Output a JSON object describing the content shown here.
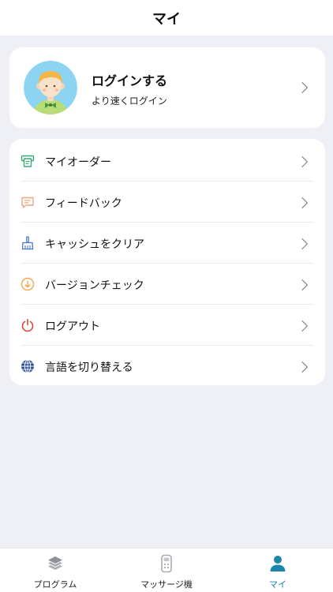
{
  "header": {
    "title": "マイ"
  },
  "profile": {
    "title": "ログインする",
    "subtitle": "より速くログイン",
    "avatar_icon": "boy-avatar-icon"
  },
  "menu": {
    "items": [
      {
        "label": "マイオーダー",
        "icon": "receipt-printer-icon",
        "icon_color": "#3aa873"
      },
      {
        "label": "フィードバック",
        "icon": "message-icon",
        "icon_color": "#f0a47a"
      },
      {
        "label": "キャッシュをクリア",
        "icon": "broom-icon",
        "icon_color": "#4a78c8"
      },
      {
        "label": "バージョンチェック",
        "icon": "download-circle-icon",
        "icon_color": "#f3a54d"
      },
      {
        "label": "ログアウト",
        "icon": "power-icon",
        "icon_color": "#e0463a"
      },
      {
        "label": "言語を切り替える",
        "icon": "globe-icon",
        "icon_color": "#2c4b9a"
      }
    ]
  },
  "tabbar": {
    "tabs": [
      {
        "label": "プログラム",
        "icon": "layers-icon",
        "active": false
      },
      {
        "label": "マッサージ機",
        "icon": "remote-control-icon",
        "active": false
      },
      {
        "label": "マイ",
        "icon": "person-icon",
        "active": true
      }
    ],
    "active_color": "#1a86a8"
  }
}
